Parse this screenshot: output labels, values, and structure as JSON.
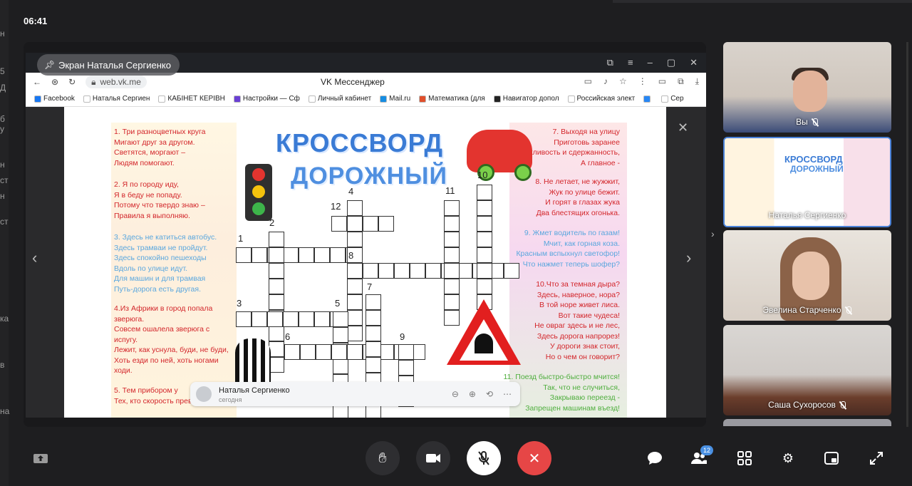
{
  "clock": "06:41",
  "left_edge_fragments": [
    "н",
    "5",
    "Д",
    "б у",
    "н",
    "ст",
    "н",
    "ст",
    "ка",
    "в",
    "на"
  ],
  "share": {
    "label": "Экран Наталья Сергиенко"
  },
  "browser": {
    "url": "web.vk.me",
    "tab_title": "VK Мессенджер",
    "bookmarks": [
      {
        "label": "Facebook",
        "color": "#1877f2"
      },
      {
        "label": "Наталья Сергиен",
        "color": "#ffffff"
      },
      {
        "label": "КАБІНЕТ КЕРІВН",
        "color": "#ffffff"
      },
      {
        "label": "Настройки — Сф",
        "color": "#6a3fd4"
      },
      {
        "label": "Личный кабинет",
        "color": "#ffffff"
      },
      {
        "label": "Mail.ru",
        "color": "#168de2"
      },
      {
        "label": "Математика (для",
        "color": "#e04f2b"
      },
      {
        "label": "Навигатор допол",
        "color": "#222222"
      },
      {
        "label": "Российская элект",
        "color": "#ffffff"
      },
      {
        "label": "",
        "color": "#2787f5"
      },
      {
        "label": "Сер",
        "color": "#ffffff"
      }
    ]
  },
  "crossword": {
    "title_line1": "КРОССВОРД",
    "title_line2": "ДОРОЖНЫЙ",
    "left_clues": [
      {
        "text": "1. Три разноцветных круга\nМигают друг за другом.\nСветятся, моргают –\nЛюдям помогают.",
        "color": "#d3262b"
      },
      {
        "text": "2. Я по городу иду,\nЯ в беду не попаду.\nПотому что твердо знаю –\nПравила я выполняю.",
        "color": "#d3262b"
      },
      {
        "text": "3. Здесь не катиться автобус.\nЗдесь трамваи не пройдут.\nЗдесь спокойно пешеходы\nВдоль по улице идут.\nДля машин и для трамвая\nПуть-дорога есть другая.",
        "color": "#5aa7de"
      },
      {
        "text": "4.Из Африки в город попала\nзверюга.\nСовсем ошалела зверюга с\nиспугу.\nЛежит, как уснула, буди, не буди,\nХоть езди по ней, хоть ногами\nходи.",
        "color": "#d3262b"
      },
      {
        "text": "5. Тем прибором у\nТех, кто скорость превы",
        "color": "#d3262b"
      }
    ],
    "right_clues": [
      {
        "text": "7. Выходя на улицу\nПриготовь заранее\nВежливость и сдержанность,\nА главное -",
        "color": "#d3262b"
      },
      {
        "text": "8. Не летает, не жужжит,\nЖук по улице бежит.\nИ горят в глазах жука\nДва блестящих огонька.",
        "color": "#d3262b"
      },
      {
        "text": "9. Жмет водитель по газам!\nМчит, как горная коза.\nКрасным вспыхнул светофор!\nЧто нажмет теперь шофер?",
        "color": "#5aa7de"
      },
      {
        "text": "10.Что за темная дыра?\nЗдесь, наверное, нора?\nВ той норе живет лиса.\nВот такие чудеса!\nНе овраг здесь и не лес,\nЗдесь дорога напрорез!\nУ дороги знак стоит,\nНо о чем он говорит?",
        "color": "#d3262b"
      },
      {
        "text": "11. Поезд быстро-быстро мчится!\nТак, что не случиться,\nЗакрываю переезд -\nЗапрещен машинам въезд!",
        "color": "#4fae3e"
      }
    ],
    "numbers": [
      "1",
      "2",
      "3",
      "4",
      "5",
      "6",
      "7",
      "8",
      "9",
      "10",
      "11",
      "12"
    ]
  },
  "message_popup": {
    "name": "Наталья Сергиенко",
    "sub": "сегодня"
  },
  "participants": [
    {
      "name": "Вы",
      "muted": true
    },
    {
      "name": "Наталья Сергиенко",
      "muted": false,
      "mini_title1": "КРОССВОРД",
      "mini_title2": "ДОРОЖНЫЙ"
    },
    {
      "name": "Эвелина Старченко",
      "muted": true
    },
    {
      "name": "Саша Сухоросов",
      "muted": true
    }
  ],
  "controls": {
    "participants_count": "12"
  },
  "colors": {
    "end_call": "#e64646",
    "active_tile_border": "#4a82d8",
    "badge": "#4a90e2"
  }
}
